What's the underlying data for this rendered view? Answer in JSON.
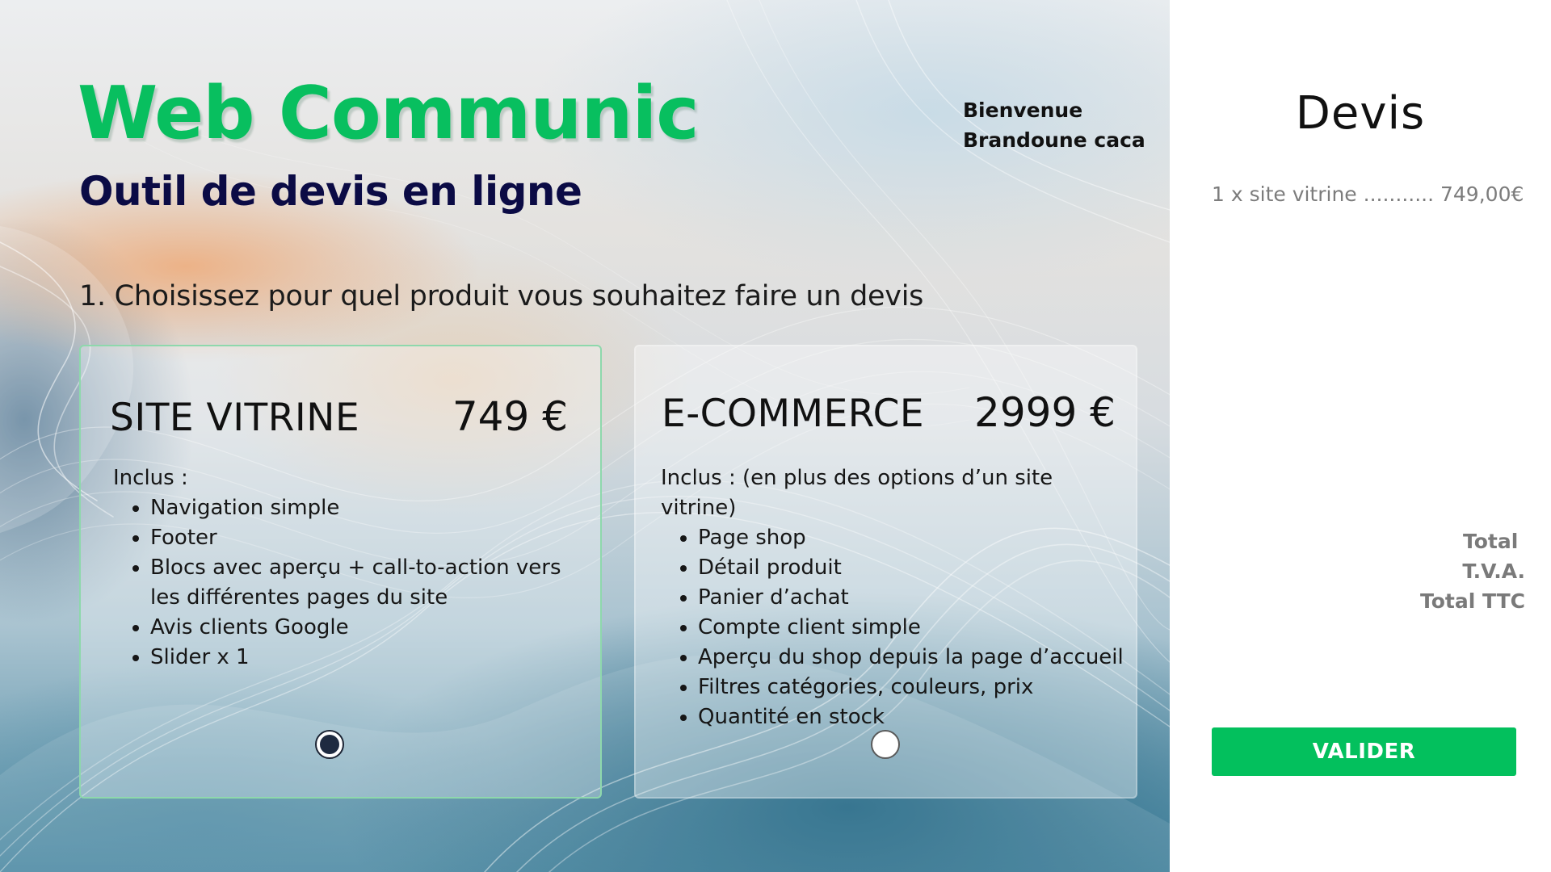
{
  "header": {
    "brand_title": "Web Communic",
    "brand_subtitle": "Outil de devis en ligne",
    "welcome_line1": "Bienvenue",
    "welcome_line2": "Brandoune caca"
  },
  "step": {
    "title": "1. Choisissez pour quel produit vous souhaitez faire un devis"
  },
  "products": [
    {
      "name": "SITE VITRINE",
      "price": "749 €",
      "includes_label": "Inclus :",
      "features": [
        "Navigation simple",
        "Footer",
        "Blocs avec aperçu +  call-to-action vers les différentes pages du site",
        "Avis clients Google",
        "Slider x 1"
      ],
      "selected": true
    },
    {
      "name": "E-COMMERCE",
      "price": "2999 €",
      "includes_label": "Inclus : (en plus des options d’un site vitrine)",
      "features": [
        "Page shop",
        "Détail produit",
        "Panier d’achat",
        "Compte client simple",
        "Aperçu du shop depuis la page d’accueil",
        "Filtres catégories, couleurs, prix",
        "Quantité en stock"
      ],
      "selected": false
    }
  ],
  "quote": {
    "title": "Devis",
    "line_item": "1 x site vitrine ........... 749,00€",
    "total_label": "Total ",
    "vat_label": "T.V.A.",
    "total_ttc_label": "Total TTC",
    "validate_label": "VALIDER"
  },
  "colors": {
    "brand_green": "#08bf5f",
    "subtitle_navy": "#0b0b45",
    "button_green": "#03c05d",
    "selected_card_border": "#8ed8ac",
    "muted_gray": "#7a7a7a"
  }
}
